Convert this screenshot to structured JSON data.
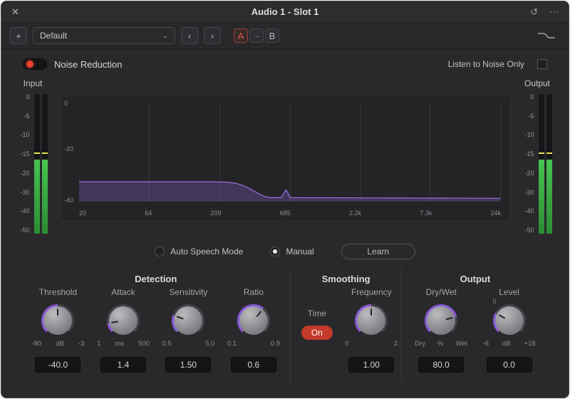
{
  "titlebar": {
    "title": "Audio 1 - Slot 1",
    "close": "✕",
    "history_icon": "↺",
    "menu_icon": "⋯"
  },
  "toolbar": {
    "add": "+",
    "preset": "Default",
    "chevron": "⌄",
    "prev": "‹",
    "next": "›",
    "a": "A",
    "ab_arrow": "→",
    "b": "B"
  },
  "header": {
    "plugin": "Noise Reduction",
    "listen": "Listen to Noise Only"
  },
  "meters": {
    "input_label": "Input",
    "output_label": "Output",
    "ticks": [
      "0",
      "-5",
      "-10",
      "-15",
      "-20",
      "-30",
      "-40",
      "-50"
    ]
  },
  "graph": {
    "y_ticks": [
      "0",
      "-20",
      "-40"
    ],
    "x_ticks": [
      "20",
      "64",
      "209",
      "685",
      "2.2k",
      "7.3k",
      "24k"
    ]
  },
  "modes": {
    "auto": "Auto Speech Mode",
    "manual": "Manual",
    "learn": "Learn"
  },
  "controls": {
    "detection": {
      "title": "Detection",
      "knobs": [
        {
          "label": "Threshold",
          "min": "-80",
          "unit": "dB",
          "max": "-3",
          "value": "-40.0",
          "angle": 0
        },
        {
          "label": "Attack",
          "min": "1",
          "unit": "ms",
          "max": "500",
          "value": "1.4",
          "angle": -100
        },
        {
          "label": "Sensitivity",
          "min": "0.5",
          "unit": "",
          "max": "5.0",
          "value": "1.50",
          "angle": -70
        },
        {
          "label": "Ratio",
          "min": "0.1",
          "unit": "",
          "max": "0.9",
          "value": "0.6",
          "angle": 38
        }
      ]
    },
    "smoothing": {
      "title": "Smoothing",
      "time_label": "Time",
      "time_value": "On",
      "knobs": [
        {
          "label": "Frequency",
          "min": "0",
          "unit": "",
          "max": "2",
          "value": "1.00",
          "angle": 0
        }
      ]
    },
    "output": {
      "title": "Output",
      "knobs": [
        {
          "label": "Dry/Wet",
          "min": "Dry",
          "unit": "%",
          "max": "Wet",
          "value": "80.0",
          "angle": 76
        },
        {
          "label": "Level",
          "min": "-6",
          "unit": "dB",
          "max": "+18",
          "value": "0.0",
          "zero_label": "0",
          "angle": -62
        }
      ]
    }
  }
}
